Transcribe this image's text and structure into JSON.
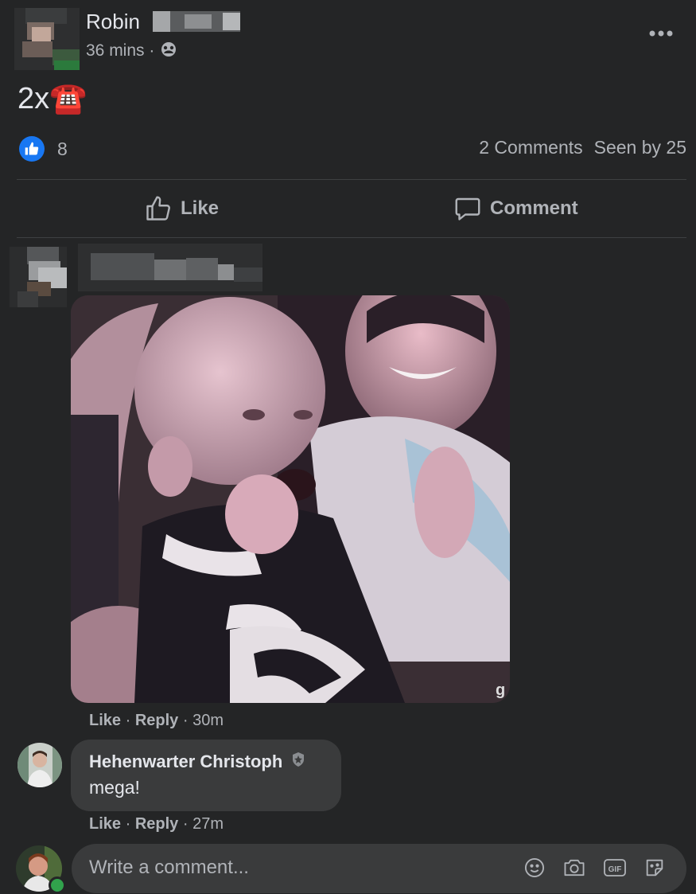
{
  "post": {
    "author_name": "Robin",
    "time": "36 mins",
    "separator": "·",
    "text": "2x☎️",
    "like_count": "8",
    "comments_count": "2 Comments",
    "seen_by": "Seen by 25"
  },
  "actions": {
    "like_label": "Like",
    "comment_label": "Comment"
  },
  "comments": [
    {
      "like": "Like",
      "reply": "Reply",
      "time": "30m"
    },
    {
      "author": "Hehenwarter Christoph",
      "text": "mega!",
      "like": "Like",
      "reply": "Reply",
      "time": "27m"
    }
  ],
  "composer": {
    "placeholder": "Write a comment..."
  },
  "colors": {
    "background": "#242526",
    "bubble": "#3a3b3c",
    "like_blue": "#1877f2",
    "secondary_text": "#b0b3b8",
    "online_green": "#31a24c"
  },
  "icons": [
    "more-icon",
    "audience-icon",
    "like-reaction-icon",
    "thumbs-up-icon",
    "comment-icon",
    "verified-badge-icon",
    "emoji-icon",
    "camera-icon",
    "gif-icon",
    "sticker-icon"
  ]
}
